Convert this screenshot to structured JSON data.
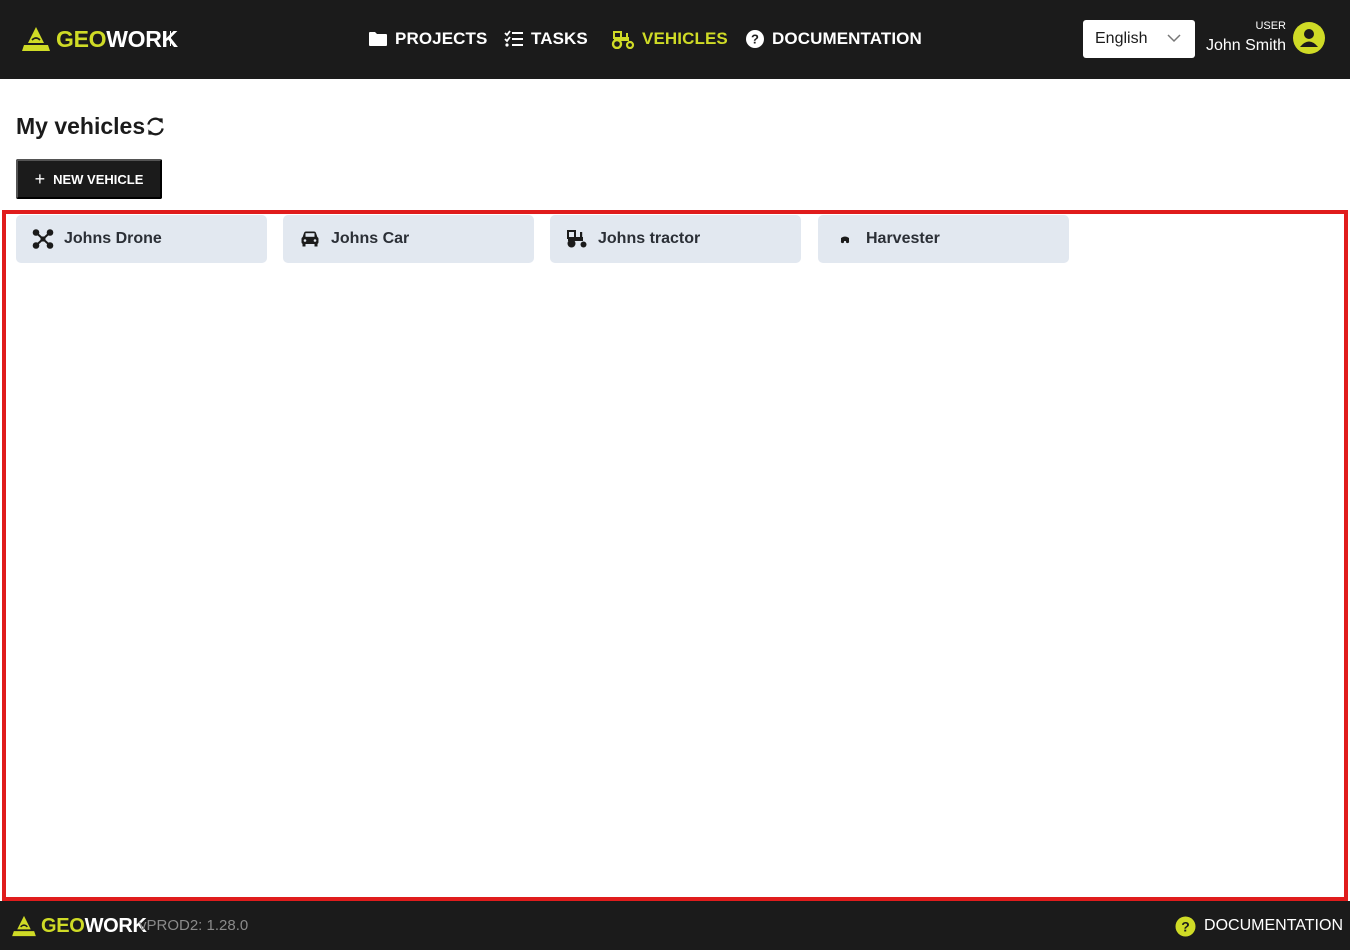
{
  "header": {
    "logo": {
      "part1": "GEO",
      "part2": "WORK"
    },
    "nav": [
      {
        "label": "PROJECTS",
        "icon": "folder-icon",
        "active": false
      },
      {
        "label": "TASKS",
        "icon": "tasks-list-icon",
        "active": false
      },
      {
        "label": "VEHICLES",
        "icon": "tractor-icon",
        "active": true
      },
      {
        "label": "DOCUMENTATION",
        "icon": "help-circle-icon",
        "active": false
      }
    ],
    "language": {
      "selected": "English"
    },
    "user": {
      "role": "USER",
      "name": "John Smith",
      "icon": "user-circle-icon"
    }
  },
  "page": {
    "title": "My vehicles",
    "refresh_icon": "refresh-icon",
    "new_button": {
      "plus": "+",
      "label": "NEW VEHICLE"
    }
  },
  "vehicles": [
    {
      "name": "Johns Drone",
      "icon": "drone-icon"
    },
    {
      "name": "Johns Car",
      "icon": "car-icon"
    },
    {
      "name": "Johns tractor",
      "icon": "tractor-icon"
    },
    {
      "name": "Harvester",
      "icon": "harvester-icon"
    }
  ],
  "footer": {
    "logo": {
      "part1": "GEO",
      "part2": "WORK"
    },
    "version": "vPROD2: 1.28.0",
    "docs_label": "DOCUMENTATION"
  },
  "colors": {
    "accent": "#cfdb26",
    "dark": "#1b1b1b",
    "card_bg": "#e2e8f0",
    "frame_border": "#e01c1c"
  }
}
